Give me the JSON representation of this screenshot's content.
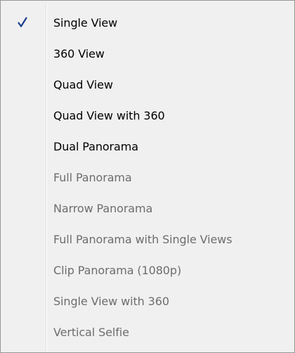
{
  "menu": {
    "items": [
      {
        "label": "Single View",
        "checked": true,
        "enabled": true
      },
      {
        "label": "360 View",
        "checked": false,
        "enabled": true
      },
      {
        "label": "Quad View",
        "checked": false,
        "enabled": true
      },
      {
        "label": "Quad View with 360",
        "checked": false,
        "enabled": true
      },
      {
        "label": "Dual Panorama",
        "checked": false,
        "enabled": true
      },
      {
        "label": "Full Panorama",
        "checked": false,
        "enabled": false
      },
      {
        "label": "Narrow Panorama",
        "checked": false,
        "enabled": false
      },
      {
        "label": "Full Panorama with Single Views",
        "checked": false,
        "enabled": false
      },
      {
        "label": "Clip Panorama (1080p)",
        "checked": false,
        "enabled": false
      },
      {
        "label": "Single View with 360",
        "checked": false,
        "enabled": false
      },
      {
        "label": "Vertical Selfie",
        "checked": false,
        "enabled": false
      }
    ],
    "check_icon": "checkmark-icon",
    "check_color": "#1c3e8e"
  }
}
